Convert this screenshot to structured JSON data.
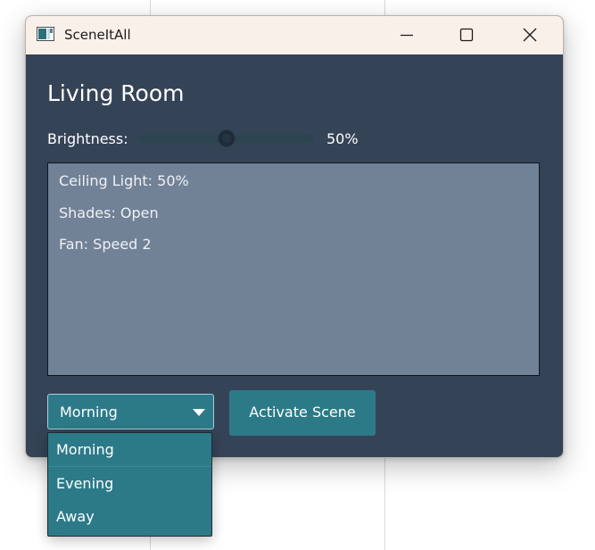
{
  "window": {
    "title": "SceneItAll",
    "controls": {
      "minimize_icon": "minimize-icon",
      "maximize_icon": "maximize-icon",
      "close_icon": "close-icon"
    }
  },
  "room": {
    "title": "Living Room"
  },
  "brightness": {
    "label": "Brightness:",
    "value": 50,
    "value_text": "50%"
  },
  "devices": [
    "Ceiling Light: 50%",
    "Shades: Open",
    "Fan: Speed 2"
  ],
  "scene": {
    "selected": "Morning",
    "options": [
      "Morning",
      "Evening",
      "Away"
    ],
    "activate_label": "Activate Scene"
  },
  "colors": {
    "window_bg": "#354357",
    "titlebar_bg": "#f9f0ea",
    "accent": "#2c7a88",
    "list_bg": "#718297"
  }
}
